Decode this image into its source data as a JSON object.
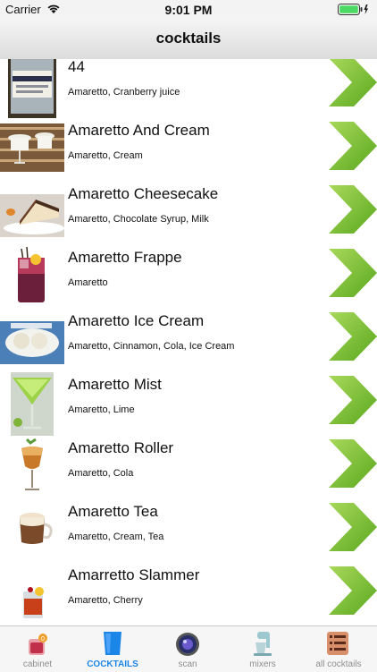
{
  "status": {
    "carrier": "Carrier",
    "time": "9:01 PM"
  },
  "nav": {
    "title": "cocktails"
  },
  "list": [
    {
      "name": "44",
      "ingredients": "Amaretto, Cranberry juice"
    },
    {
      "name": "Amaretto And Cream",
      "ingredients": "Amaretto, Cream"
    },
    {
      "name": "Amaretto Cheesecake",
      "ingredients": "Amaretto, Chocolate Syrup, Milk"
    },
    {
      "name": "Amaretto Frappe",
      "ingredients": "Amaretto"
    },
    {
      "name": "Amaretto Ice Cream",
      "ingredients": "Amaretto, Cinnamon, Cola, Ice Cream"
    },
    {
      "name": "Amaretto Mist",
      "ingredients": "Amaretto, Lime"
    },
    {
      "name": "Amaretto Roller",
      "ingredients": "Amaretto, Cola"
    },
    {
      "name": "Amaretto Tea",
      "ingredients": "Amaretto, Cream, Tea"
    },
    {
      "name": "Amarretto Slammer",
      "ingredients": "Amaretto, Cherry"
    }
  ],
  "tabs": [
    {
      "label": "cabinet",
      "icon": "cabinet-icon"
    },
    {
      "label": "COCKTAILS",
      "icon": "cocktails-icon"
    },
    {
      "label": "scan",
      "icon": "scan-icon"
    },
    {
      "label": "mixers",
      "icon": "mixers-icon"
    },
    {
      "label": "all cocktails",
      "icon": "all-cocktails-icon"
    }
  ],
  "colors": {
    "accent": "#1c86e8",
    "chevron_light": "#a8d85a",
    "chevron_dark": "#5aa81e"
  }
}
